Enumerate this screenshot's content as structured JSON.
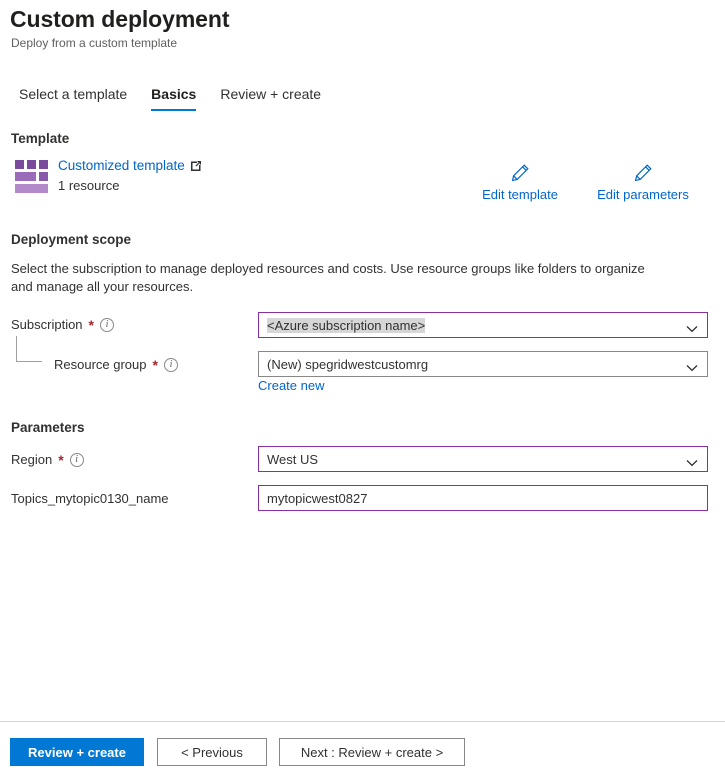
{
  "header": {
    "title": "Custom deployment",
    "subtitle": "Deploy from a custom template"
  },
  "tabs": [
    {
      "label": "Select a template",
      "active": false
    },
    {
      "label": "Basics",
      "active": true
    },
    {
      "label": "Review + create",
      "active": false
    }
  ],
  "template": {
    "heading": "Template",
    "icon": "template-grid-icon",
    "link_label": "Customized template",
    "link_external_icon": "external-link-icon",
    "resource_count": "1 resource",
    "edit_template_label": "Edit template",
    "edit_parameters_label": "Edit parameters",
    "pencil_icon": "pencil-icon"
  },
  "deployment_scope": {
    "heading": "Deployment scope",
    "description": "Select the subscription to manage deployed resources and costs. Use resource groups like folders to organize and manage all your resources.",
    "subscription": {
      "label": "Subscription",
      "required_marker": "*",
      "info_icon": "info-icon",
      "value": "<Azure subscription name>",
      "chevron_icon": "chevron-down-icon"
    },
    "resource_group": {
      "label": "Resource group",
      "required_marker": "*",
      "info_icon": "info-icon",
      "value": "(New) spegridwestcustomrg",
      "chevron_icon": "chevron-down-icon",
      "create_new_label": "Create new"
    }
  },
  "parameters": {
    "heading": "Parameters",
    "region": {
      "label": "Region",
      "required_marker": "*",
      "info_icon": "info-icon",
      "value": "West US",
      "chevron_icon": "chevron-down-icon"
    },
    "topic_name": {
      "label": "Topics_mytopic0130_name",
      "value": "mytopicwest0827"
    }
  },
  "footer": {
    "review_create_label": "Review + create",
    "previous_label": "< Previous",
    "next_label": "Next : Review + create >"
  },
  "colors": {
    "accent_blue": "#0078d4",
    "link_blue": "#0066cc",
    "required_red": "#a4262c",
    "field_focus_purple": "#8b2fa0",
    "template_purple": "#7a4b9c"
  }
}
